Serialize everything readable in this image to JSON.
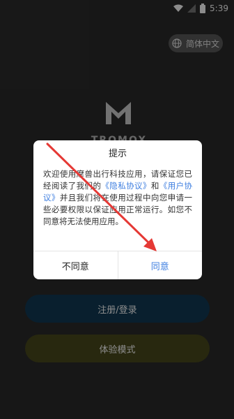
{
  "status_bar": {
    "time": "5:39"
  },
  "language": {
    "label": "简体中文"
  },
  "logo": {
    "text": "TROMOX"
  },
  "dialog": {
    "title": "提示",
    "body_prefix": "欢迎使用摩兽出行科技应用，请保证您已经阅读了我们的",
    "privacy_link": "《隐私协议》",
    "and_text": "和",
    "user_link": "《用户协议》",
    "body_suffix": "并且我们将在使用过程中向您申请一些必要权限以保证应用正常运行。如您不同意将无法使用应用。",
    "disagree_label": "不同意",
    "agree_label": "同意"
  },
  "buttons": {
    "register_label": "注册/登录",
    "trial_label": "体验模式"
  },
  "colors": {
    "background": "#2b2b2b",
    "link_blue": "#3f7fe0",
    "register_btn": "#123a54",
    "trial_btn": "#4a4a1c",
    "annotation_red": "#e53935"
  }
}
